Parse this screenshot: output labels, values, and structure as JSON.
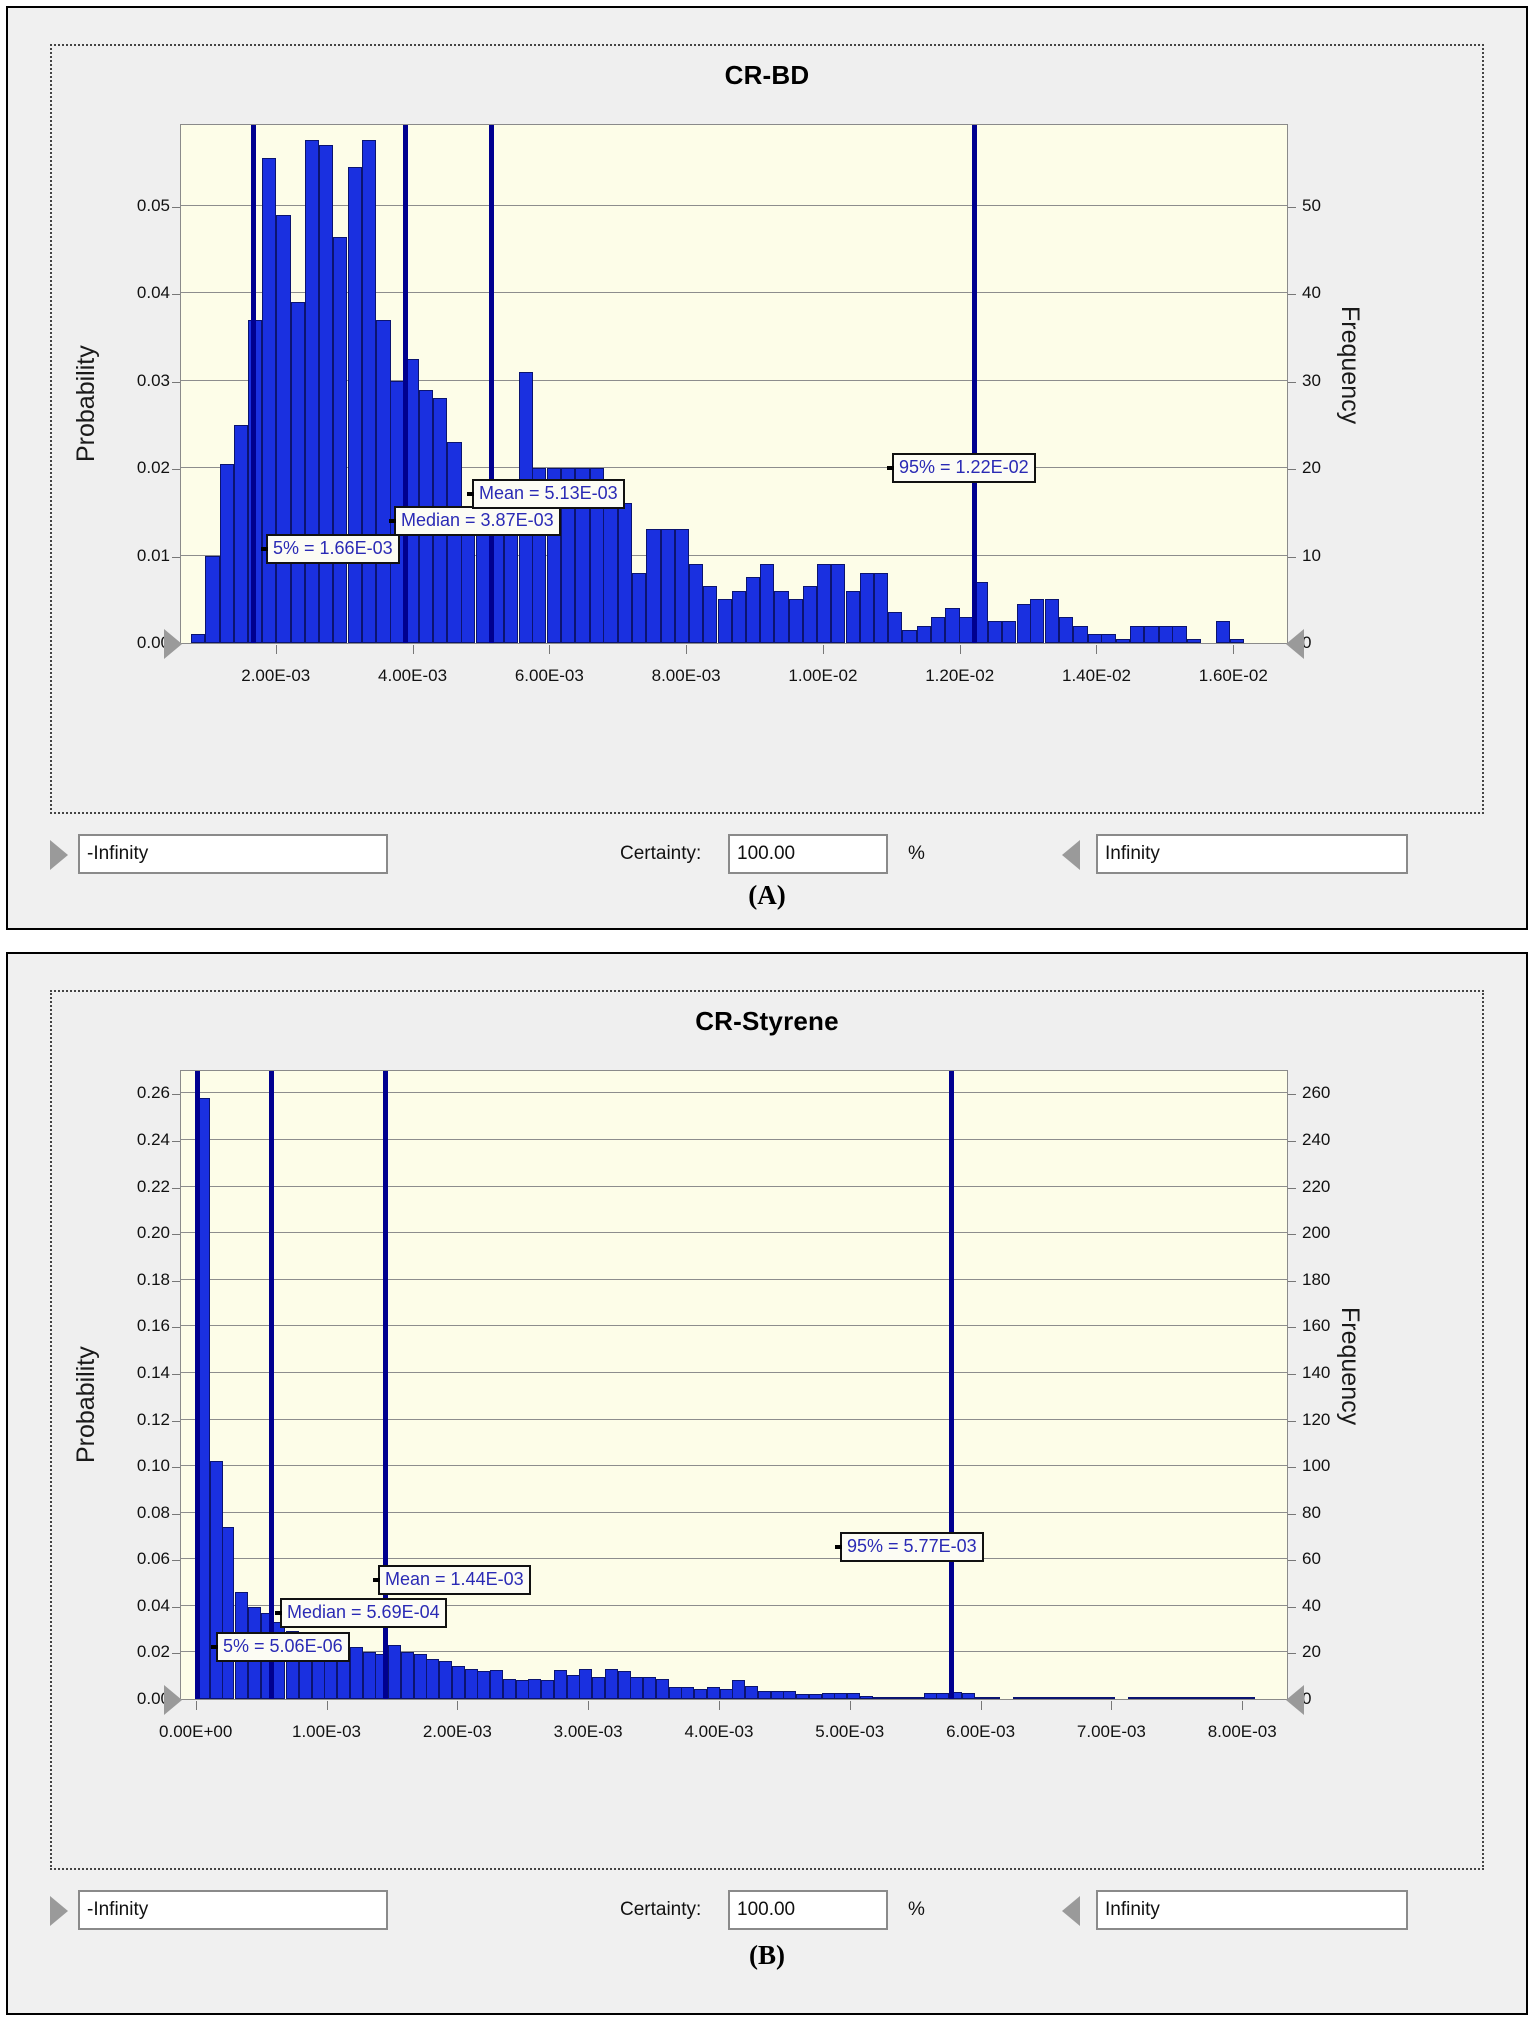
{
  "charts": [
    {
      "id": "A",
      "title": "CR-BD",
      "caption": "(A)",
      "ylabel": "Probability",
      "yrlabel": "Frequency",
      "y_ticks": [
        "0.00",
        "0.01",
        "0.02",
        "0.03",
        "0.04",
        "0.05"
      ],
      "y_values": [
        0.0,
        0.01,
        0.02,
        0.03,
        0.04,
        0.05
      ],
      "yr_ticks": [
        "0",
        "10",
        "20",
        "30",
        "40",
        "50"
      ],
      "yr_values": [
        0,
        10,
        20,
        30,
        40,
        50
      ],
      "x_ticks": [
        "2.00E-03",
        "4.00E-03",
        "6.00E-03",
        "8.00E-03",
        "1.00E-02",
        "1.20E-02",
        "1.40E-02",
        "1.60E-02"
      ],
      "x_values": [
        0.002,
        0.004,
        0.006,
        0.008,
        0.01,
        0.012,
        0.014,
        0.016
      ],
      "markers": [
        {
          "name": "p5",
          "label": "5% = 1.66E-03",
          "x": 0.00166
        },
        {
          "name": "median",
          "label": "Median = 3.87E-03",
          "x": 0.00387
        },
        {
          "name": "mean",
          "label": "Mean = 5.13E-03",
          "x": 0.00513
        },
        {
          "name": "p95",
          "label": "95% = 1.22E-02",
          "x": 0.0122
        }
      ],
      "footer": {
        "left_value": "-Infinity",
        "certainty_label": "Certainty:",
        "certainty_value": "100.00",
        "percent": "%",
        "right_value": "Infinity"
      },
      "chart_data": {
        "type": "bar",
        "title": "CR-BD",
        "xlabel": "",
        "ylabel": "Probability",
        "y2label": "Frequency",
        "xlim": [
          0.0006,
          0.0168
        ],
        "ylim": [
          0,
          0.0595
        ],
        "y2lim": [
          0,
          59.5
        ],
        "grid": true,
        "legend": "none",
        "bin_width": 0.000208,
        "x": [
          0.00085,
          0.00106,
          0.00127,
          0.00148,
          0.00168,
          0.00189,
          0.0021,
          0.00231,
          0.00252,
          0.00272,
          0.00293,
          0.00314,
          0.00335,
          0.00356,
          0.00376,
          0.00397,
          0.00418,
          0.00439,
          0.0046,
          0.0048,
          0.00501,
          0.00522,
          0.00543,
          0.00564,
          0.00584,
          0.00605,
          0.00626,
          0.00647,
          0.00668,
          0.00688,
          0.00709,
          0.0073,
          0.00751,
          0.00772,
          0.00792,
          0.00813,
          0.00834,
          0.00855,
          0.00876,
          0.00896,
          0.00917,
          0.00938,
          0.00959,
          0.0098,
          0.01,
          0.01021,
          0.01042,
          0.01063,
          0.01084,
          0.01104,
          0.01125,
          0.01146,
          0.01167,
          0.01188,
          0.01208,
          0.01229,
          0.0125,
          0.01271,
          0.01292,
          0.01312,
          0.01333,
          0.01354,
          0.01375,
          0.01396,
          0.01416,
          0.01437,
          0.01458,
          0.01479,
          0.015,
          0.0152,
          0.01541,
          0.01562,
          0.01583,
          0.01604
        ],
        "values": [
          0.001,
          0.01,
          0.0205,
          0.025,
          0.037,
          0.0555,
          0.049,
          0.039,
          0.0575,
          0.057,
          0.0465,
          0.0545,
          0.0575,
          0.037,
          0.03,
          0.0325,
          0.029,
          0.028,
          0.023,
          0.0155,
          0.0155,
          0.015,
          0.0155,
          0.031,
          0.02,
          0.02,
          0.02,
          0.02,
          0.02,
          0.016,
          0.016,
          0.008,
          0.013,
          0.013,
          0.013,
          0.009,
          0.0065,
          0.005,
          0.006,
          0.0075,
          0.009,
          0.006,
          0.005,
          0.0065,
          0.009,
          0.009,
          0.006,
          0.008,
          0.008,
          0.0035,
          0.0015,
          0.002,
          0.003,
          0.004,
          0.003,
          0.007,
          0.0025,
          0.0025,
          0.0045,
          0.005,
          0.005,
          0.003,
          0.002,
          0.001,
          0.001,
          0.0005,
          0.002,
          0.002,
          0.002,
          0.002,
          0.0005,
          0.0,
          0.0025,
          0.0005
        ]
      }
    },
    {
      "id": "B",
      "title": "CR-Styrene",
      "caption": "(B)",
      "ylabel": "Probability",
      "yrlabel": "Frequency",
      "y_ticks": [
        "0.00",
        "0.02",
        "0.04",
        "0.06",
        "0.08",
        "0.10",
        "0.12",
        "0.14",
        "0.16",
        "0.18",
        "0.20",
        "0.22",
        "0.24",
        "0.26"
      ],
      "y_values": [
        0.0,
        0.02,
        0.04,
        0.06,
        0.08,
        0.1,
        0.12,
        0.14,
        0.16,
        0.18,
        0.2,
        0.22,
        0.24,
        0.26
      ],
      "yr_ticks": [
        "0",
        "20",
        "40",
        "60",
        "80",
        "100",
        "120",
        "140",
        "160",
        "180",
        "200",
        "220",
        "240",
        "260"
      ],
      "yr_values": [
        0,
        20,
        40,
        60,
        80,
        100,
        120,
        140,
        160,
        180,
        200,
        220,
        240,
        260
      ],
      "x_ticks": [
        "0.00E+00",
        "1.00E-03",
        "2.00E-03",
        "3.00E-03",
        "4.00E-03",
        "5.00E-03",
        "6.00E-03",
        "7.00E-03",
        "8.00E-03"
      ],
      "x_values": [
        0.0,
        0.001,
        0.002,
        0.003,
        0.004,
        0.005,
        0.006,
        0.007,
        0.008
      ],
      "markers": [
        {
          "name": "p5",
          "label": "5% = 5.06E-06",
          "x": 5.06e-06
        },
        {
          "name": "median",
          "label": "Median = 5.69E-04",
          "x": 0.000569
        },
        {
          "name": "mean",
          "label": "Mean = 1.44E-03",
          "x": 0.00144
        },
        {
          "name": "p95",
          "label": "95% = 5.77E-03",
          "x": 0.00577
        }
      ],
      "footer": {
        "left_value": "-Infinity",
        "certainty_label": "Certainty:",
        "certainty_value": "100.00",
        "percent": "%",
        "right_value": "Infinity"
      },
      "chart_data": {
        "type": "bar",
        "title": "CR-Styrene",
        "xlabel": "",
        "ylabel": "Probability",
        "y2label": "Frequency",
        "xlim": [
          -0.00012,
          0.00835
        ],
        "ylim": [
          0,
          0.2705
        ],
        "y2lim": [
          0,
          270.5
        ],
        "grid": true,
        "legend": "none",
        "bin_width": 9.75e-05,
        "x": [
          5e-05,
          0.00015,
          0.00024,
          0.00034,
          0.00044,
          0.00054,
          0.00063,
          0.00073,
          0.00083,
          0.00093,
          0.00102,
          0.00112,
          0.00122,
          0.00132,
          0.00141,
          0.00151,
          0.00161,
          0.00171,
          0.0018,
          0.0019,
          0.002,
          0.0021,
          0.00219,
          0.00229,
          0.00239,
          0.00249,
          0.00258,
          0.00268,
          0.00278,
          0.00288,
          0.00297,
          0.00307,
          0.00317,
          0.00327,
          0.00336,
          0.00346,
          0.00356,
          0.00366,
          0.00375,
          0.00385,
          0.00395,
          0.00405,
          0.00414,
          0.00424,
          0.00434,
          0.00444,
          0.00453,
          0.00463,
          0.00473,
          0.00483,
          0.00492,
          0.00502,
          0.00512,
          0.00522,
          0.00531,
          0.00541,
          0.00551,
          0.00561,
          0.0057,
          0.0058,
          0.0059,
          0.006,
          0.00609,
          0.00619,
          0.00629,
          0.00639,
          0.00648,
          0.00658,
          0.00668,
          0.00678,
          0.00687,
          0.00697,
          0.00707,
          0.00717,
          0.00726,
          0.00736,
          0.00746,
          0.00756,
          0.00765,
          0.00775,
          0.00785,
          0.00795,
          0.00804,
          0.00814
        ],
        "values": [
          0.258,
          0.102,
          0.074,
          0.046,
          0.0395,
          0.037,
          0.033,
          0.029,
          0.027,
          0.027,
          0.0265,
          0.025,
          0.0225,
          0.02,
          0.0195,
          0.023,
          0.02,
          0.0195,
          0.017,
          0.0165,
          0.014,
          0.013,
          0.012,
          0.0125,
          0.0085,
          0.008,
          0.0085,
          0.008,
          0.0125,
          0.0105,
          0.013,
          0.0095,
          0.013,
          0.012,
          0.0095,
          0.0095,
          0.0085,
          0.005,
          0.005,
          0.0045,
          0.005,
          0.0045,
          0.008,
          0.0055,
          0.0035,
          0.0035,
          0.0035,
          0.002,
          0.002,
          0.0025,
          0.0025,
          0.0025,
          0.0015,
          0.001,
          0.001,
          0.001,
          0.001,
          0.0025,
          0.0025,
          0.003,
          0.0025,
          0.001,
          0.0005,
          0.0,
          0.001,
          0.001,
          0.001,
          0.001,
          0.0005,
          0.001,
          0.001,
          0.0005,
          0.0,
          0.0005,
          0.0005,
          0.001,
          0.001,
          0.001,
          0.001,
          0.001,
          0.0005,
          0.0005,
          0.001,
          0.0
        ]
      }
    }
  ]
}
